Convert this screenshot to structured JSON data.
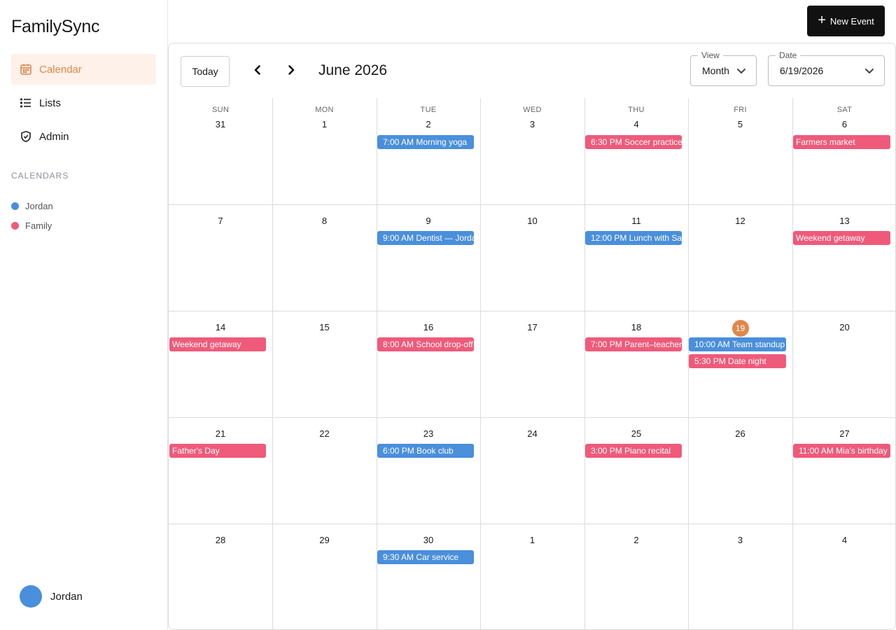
{
  "app": {
    "title": "FamilySync"
  },
  "sidebar": {
    "nav": [
      {
        "label": "Calendar",
        "icon": "calendar-icon",
        "active": true
      },
      {
        "label": "Lists",
        "icon": "list-icon",
        "active": false
      },
      {
        "label": "Admin",
        "icon": "shield-icon",
        "active": false
      }
    ],
    "calendars_heading": "CALENDARS",
    "calendars": [
      {
        "name": "Jordan",
        "color": "#4a8fdb"
      },
      {
        "name": "Family",
        "color": "#ef5a7a"
      }
    ],
    "user": {
      "name": "Jordan",
      "avatar_color": "#4a8fdb"
    }
  },
  "header": {
    "new_event_label": "New Event"
  },
  "toolbar": {
    "today_label": "Today",
    "month_title": "June 2026",
    "view": {
      "label": "View",
      "value": "Month"
    },
    "date": {
      "label": "Date",
      "value": "6/19/2026"
    }
  },
  "colors": {
    "accent": "#e0874a",
    "jordan": "#4a8fdb",
    "family": "#ef5a7a"
  },
  "calendar": {
    "weekdays": [
      "SUN",
      "MON",
      "TUE",
      "WED",
      "THU",
      "FRI",
      "SAT"
    ],
    "today": "19",
    "weeks": [
      [
        "31",
        "1",
        "2",
        "3",
        "4",
        "5",
        "6"
      ],
      [
        "7",
        "8",
        "9",
        "10",
        "11",
        "12",
        "13"
      ],
      [
        "14",
        "15",
        "16",
        "17",
        "18",
        "19",
        "20"
      ],
      [
        "21",
        "22",
        "23",
        "24",
        "25",
        "26",
        "27"
      ],
      [
        "28",
        "29",
        "30",
        "1",
        "2",
        "3",
        "4"
      ]
    ],
    "events": [
      {
        "week": 0,
        "day": 2,
        "slot": 0,
        "time": "7:00 AM",
        "title": "Morning yoga",
        "calendar": "jordan"
      },
      {
        "week": 0,
        "day": 4,
        "slot": 0,
        "time": "6:30 PM",
        "title": "Soccer practice",
        "calendar": "family"
      },
      {
        "week": 0,
        "day": 6,
        "slot": 0,
        "time": "",
        "title": "Farmers market",
        "calendar": "family"
      },
      {
        "week": 1,
        "day": 2,
        "slot": 0,
        "time": "9:00 AM",
        "title": "Dentist — Jordan",
        "calendar": "jordan"
      },
      {
        "week": 1,
        "day": 4,
        "slot": 0,
        "time": "12:00 PM",
        "title": "Lunch with Sam",
        "calendar": "jordan"
      },
      {
        "week": 1,
        "day": 6,
        "slot": 0,
        "time": "",
        "title": "Weekend getaway",
        "calendar": "family"
      },
      {
        "week": 2,
        "day": 0,
        "slot": 0,
        "time": "",
        "title": "Weekend getaway",
        "calendar": "family"
      },
      {
        "week": 2,
        "day": 2,
        "slot": 0,
        "time": "8:00 AM",
        "title": "School drop-off",
        "calendar": "family"
      },
      {
        "week": 2,
        "day": 4,
        "slot": 0,
        "time": "7:00 PM",
        "title": "Parent–teacher",
        "calendar": "family"
      },
      {
        "week": 2,
        "day": 5,
        "slot": 0,
        "time": "10:00 AM",
        "title": "Team standup",
        "calendar": "jordan"
      },
      {
        "week": 2,
        "day": 5,
        "slot": 1,
        "time": "5:30 PM",
        "title": "Date night",
        "calendar": "family"
      },
      {
        "week": 3,
        "day": 0,
        "slot": 0,
        "time": "",
        "title": "Father's Day",
        "calendar": "family"
      },
      {
        "week": 3,
        "day": 2,
        "slot": 0,
        "time": "6:00 PM",
        "title": "Book club",
        "calendar": "jordan"
      },
      {
        "week": 3,
        "day": 4,
        "slot": 0,
        "time": "3:00 PM",
        "title": "Piano recital",
        "calendar": "family"
      },
      {
        "week": 3,
        "day": 6,
        "slot": 0,
        "time": "11:00 AM",
        "title": "Mia's birthday",
        "calendar": "family"
      },
      {
        "week": 4,
        "day": 2,
        "slot": 0,
        "time": "9:30 AM",
        "title": "Car service",
        "calendar": "jordan"
      }
    ]
  }
}
